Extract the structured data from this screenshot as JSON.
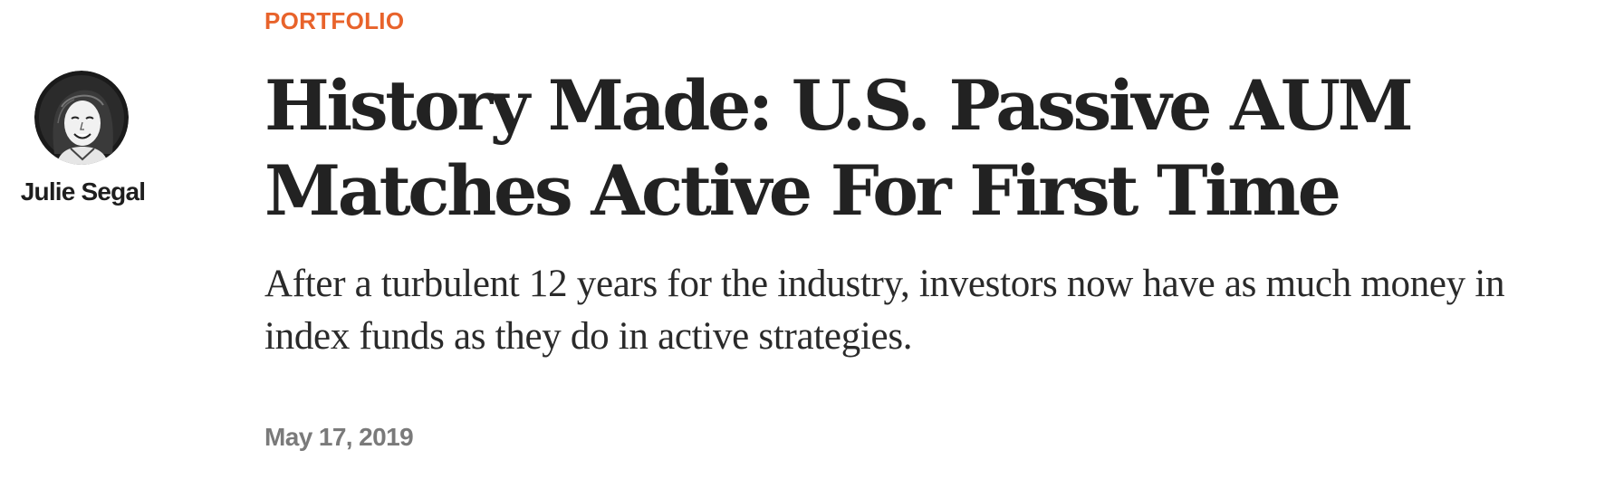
{
  "author": {
    "name": "Julie Segal",
    "avatar_icon": "author-portrait-illustration"
  },
  "article": {
    "section": "PORTFOLIO",
    "headline_line1": "History Made: U.S. Passive AUM",
    "headline_line2": "Matches Active For First Time",
    "subheadline": "After a turbulent 12 years for the industry, investors now have as much money in index funds as they do in active strategies.",
    "date": "May 17, 2019"
  },
  "colors": {
    "section_accent": "#e8632b",
    "headline": "#222222",
    "date": "#7a7a7a"
  }
}
